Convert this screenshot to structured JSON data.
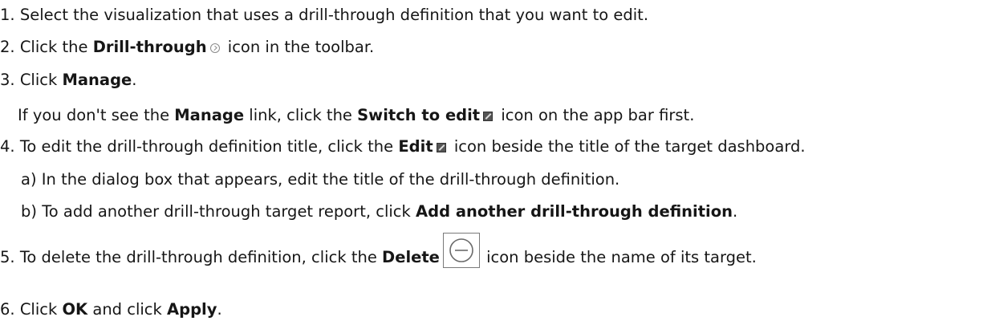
{
  "steps": {
    "s1": {
      "num": "1.",
      "text": "Select the visualization that uses a drill-through definition that you want to edit."
    },
    "s2": {
      "num": "2.",
      "pre": "Click the ",
      "bold": "Drill-through",
      "post": " icon in the toolbar."
    },
    "s3": {
      "num": "3.",
      "pre": "Click ",
      "bold": "Manage",
      "post": "."
    },
    "s3note": {
      "pre": "If you don't see the ",
      "bold1": "Manage",
      "mid": " link, click the ",
      "bold2": "Switch to edit",
      "post": " icon on the app bar first."
    },
    "s4": {
      "num": "4.",
      "pre": "To edit the drill-through definition title, click the ",
      "bold": "Edit",
      "post": " icon beside the title of the target dashboard."
    },
    "s4a": {
      "label": "a)",
      "text": "In the dialog box that appears, edit the title of the drill-through definition."
    },
    "s4b": {
      "label": "b)",
      "pre": "To add another drill-through target report, click ",
      "bold": "Add another drill-through definition",
      "post": "."
    },
    "s5": {
      "num": "5.",
      "pre": "To delete the drill-through definition, click the ",
      "bold": "Delete",
      "post": " icon beside the name of its target."
    },
    "s6": {
      "num": "6.",
      "pre": "Click ",
      "bold1": "OK",
      "mid": " and click ",
      "bold2": "Apply",
      "post": "."
    }
  },
  "icons": {
    "drill_through": "drill-through-icon",
    "switch_to_edit": "edit-icon",
    "edit": "edit-icon",
    "delete": "delete-icon"
  }
}
